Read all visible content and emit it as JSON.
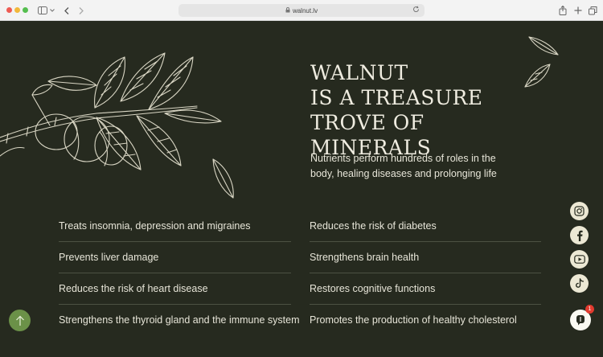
{
  "browser": {
    "url": "walnut.lv"
  },
  "hero": {
    "title_lines": [
      "WALNUT",
      "IS A TREASURE",
      "TROVE OF MINERALS"
    ],
    "subtitle": "Nutrients perform hundreds of roles in the body, healing diseases and prolonging life"
  },
  "benefits": {
    "left": [
      "Treats insomnia, depression and migraines",
      "Prevents liver damage",
      "Reduces the risk of heart disease",
      "Strengthens the thyroid gland and the immune system"
    ],
    "right": [
      "Reduces the risk of diabetes",
      "Strengthens brain health",
      "Restores cognitive functions",
      "Promotes the production of healthy cholesterol"
    ]
  },
  "social": [
    "instagram-icon",
    "facebook-icon",
    "youtube-icon",
    "tiktok-icon"
  ],
  "chat": {
    "badge_count": "1"
  },
  "colors": {
    "page_background": "#262a1f",
    "text": "#efece0",
    "scroll_button": "#6b9148",
    "social_button": "#ece8d4",
    "badge": "#e23b2f"
  }
}
